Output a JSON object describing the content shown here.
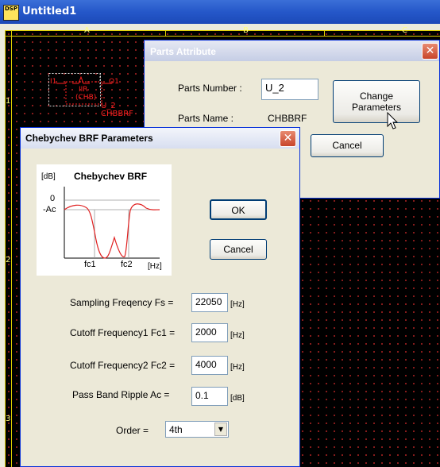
{
  "app": {
    "icon_text": "DSP",
    "title": "Untitled1"
  },
  "sheet": {
    "columns": [
      "A",
      "B",
      "C"
    ],
    "rows": [
      "1",
      "2",
      "3"
    ],
    "part": {
      "block_text_1": "IIR",
      "block_text_2": "(CHB)",
      "left_pin": "I1",
      "right_pin": "O1",
      "ref_label": "U_2",
      "name_label": "CHBBRF"
    }
  },
  "parts_attribute": {
    "title": "Parts Attribute",
    "part_number_label": "Parts Number :",
    "part_number_value": "U_2",
    "part_name_label": "Parts Name :",
    "part_name_value": "CHBBRF",
    "change_button_line1": "Change",
    "change_button_line2": "Parameters",
    "cancel_label": "Cancel"
  },
  "chebychev_dialog": {
    "title": "Chebychev BRF Parameters",
    "graph": {
      "title": "Chebychev BRF",
      "y_unit": "[dB]",
      "y_tick_zero": "0",
      "y_tick_ac": "-Ac",
      "x_tick_1": "fc1",
      "x_tick_2": "fc2",
      "x_unit": "[Hz]"
    },
    "ok_label": "OK",
    "cancel_label": "Cancel",
    "params": [
      {
        "label": "Sampling Freqency Fs =",
        "value": "22050",
        "unit": "[Hz]"
      },
      {
        "label": "Cutoff Frequency1 Fc1 =",
        "value": "2000",
        "unit": "[Hz]"
      },
      {
        "label": "Cutoff Frequency2 Fc2 =",
        "value": "4000",
        "unit": "[Hz]"
      },
      {
        "label": "Pass Band Ripple Ac =",
        "value": "0.1",
        "unit": "[dB]"
      }
    ],
    "order_label": "Order =",
    "order_value": "4th"
  },
  "colors": {
    "title_bar": "#2557c9",
    "grid_dot": "#a02020",
    "frame": "#e0d000",
    "part": "#ff2020",
    "curve": "#e02020"
  }
}
